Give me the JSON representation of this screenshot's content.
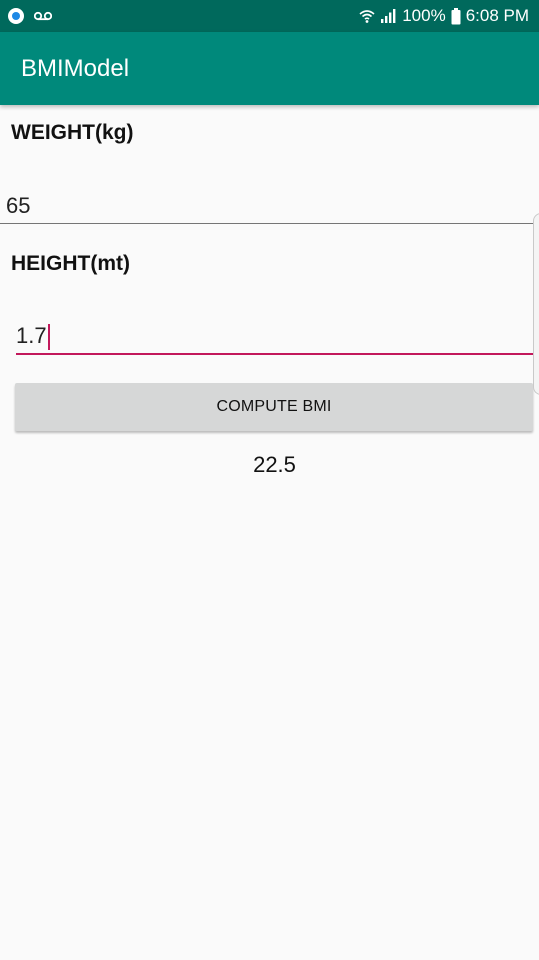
{
  "status_bar": {
    "battery_percent": "100%",
    "time": "6:08 PM",
    "icons": [
      "app-notification-icon",
      "voicemail-icon",
      "wifi-icon",
      "cell-signal-icon",
      "battery-icon"
    ]
  },
  "app_bar": {
    "title": "BMIModel",
    "color": "#00897b"
  },
  "form": {
    "weight_label": "WEIGHT(kg)",
    "weight_value": "65",
    "height_label": "HEIGHT(mt)",
    "height_value": "1.7",
    "compute_label": "COMPUTE BMI",
    "accent_color": "#c2185b"
  },
  "result": {
    "bmi": "22.5"
  }
}
